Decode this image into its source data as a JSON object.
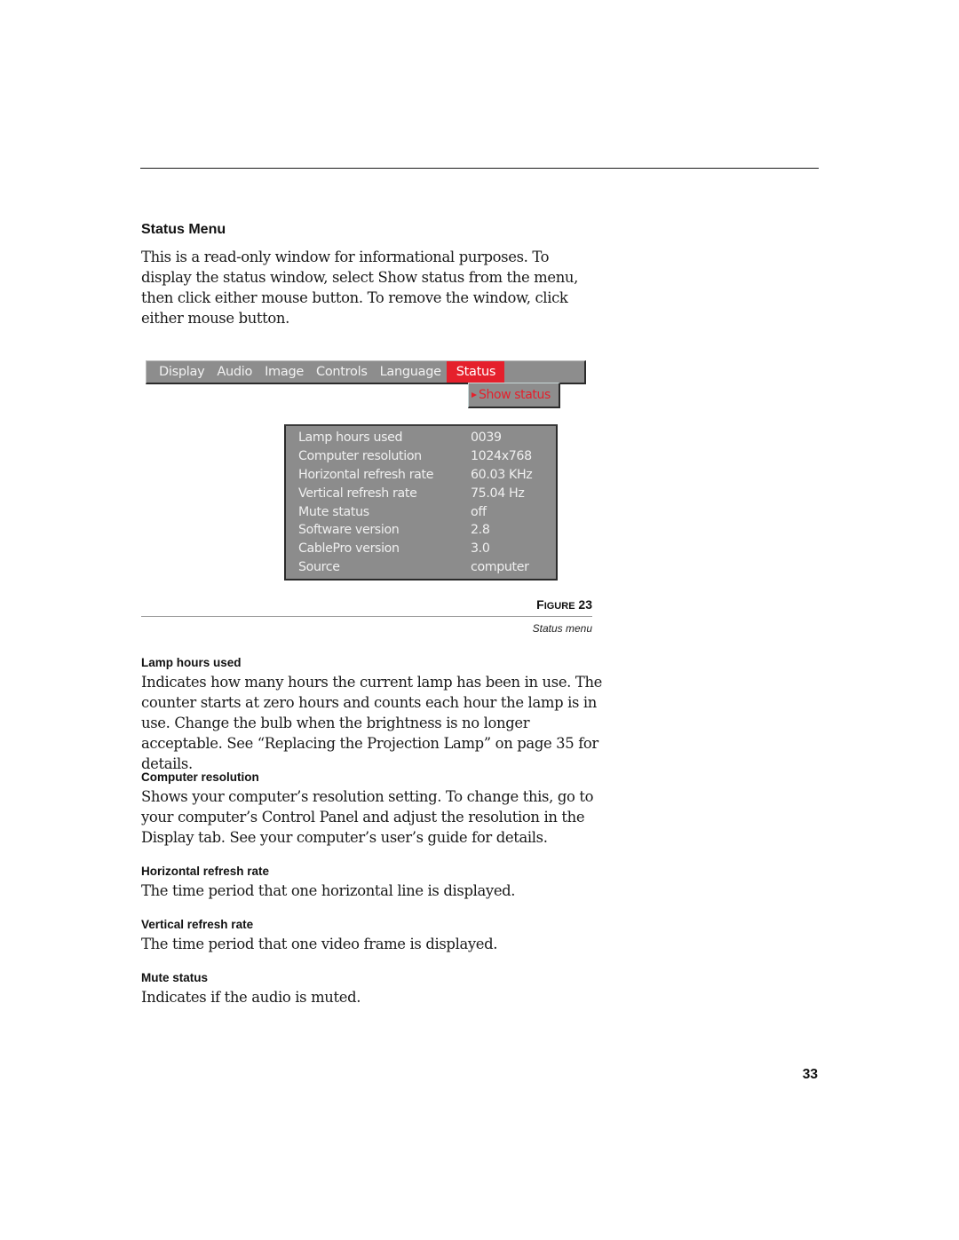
{
  "section": {
    "title": "Status Menu",
    "intro": "This is a read-only window for informational purposes. To display the status window, select Show status from the menu, then click either mouse button. To remove the window, click either mouse button."
  },
  "menu_bar": {
    "tabs": [
      {
        "label": "Display",
        "active": false
      },
      {
        "label": "Audio",
        "active": false
      },
      {
        "label": "Image",
        "active": false
      },
      {
        "label": "Controls",
        "active": false
      },
      {
        "label": "Language",
        "active": false
      },
      {
        "label": "Status",
        "active": true
      }
    ],
    "dropdown_item": "Show status",
    "accent_color": "#e5202c"
  },
  "status_window": {
    "rows": [
      {
        "label": "Lamp hours used",
        "value": "0039"
      },
      {
        "label": "Computer resolution",
        "value": "1024x768"
      },
      {
        "label": "Horizontal refresh rate",
        "value": "60.03 KHz"
      },
      {
        "label": "Vertical refresh rate",
        "value": "75.04 Hz"
      },
      {
        "label": "Mute status",
        "value": "off"
      },
      {
        "label": "Software version",
        "value": "2.8"
      },
      {
        "label": "CablePro version",
        "value": "3.0"
      },
      {
        "label": "Source",
        "value": "computer"
      }
    ]
  },
  "figure": {
    "label_first": "F",
    "label_rest": "IGURE",
    "number": "23",
    "caption": "Status menu"
  },
  "descriptions": [
    {
      "title": "Lamp hours used",
      "text": "Indicates how many hours the current lamp has been in use. The counter starts at zero hours and counts each hour the lamp is in use. Change the bulb when the brightness is no longer acceptable. See “Replacing the Projection Lamp” on page 35 for details."
    },
    {
      "title": "Computer resolution",
      "text": "Shows your computer’s resolution setting. To change this, go to your computer’s Control Panel and adjust the resolution in the Display tab. See your computer’s user’s guide for details."
    },
    {
      "title": "Horizontal refresh rate",
      "text": "The time period that one horizontal line is displayed."
    },
    {
      "title": "Vertical refresh rate",
      "text": "The time period that one video frame is displayed."
    },
    {
      "title": "Mute status",
      "text": "Indicates if the audio is muted."
    }
  ],
  "page_number": "33"
}
